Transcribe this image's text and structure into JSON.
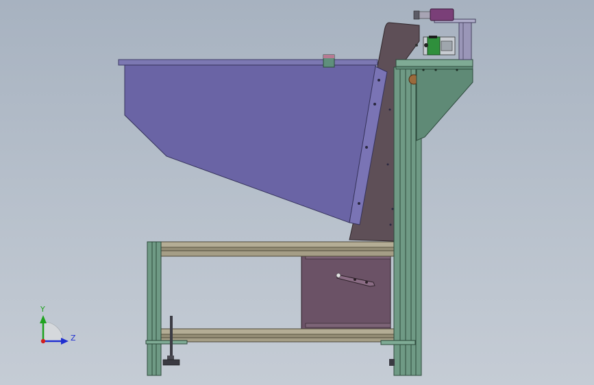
{
  "viewport": {
    "background_top": "#a7b2c0",
    "background_bottom": "#c5ccd5"
  },
  "model": {
    "colors": {
      "hopper_plate": "#6a64a5",
      "back_panel": "#5e4f57",
      "frame_green": "#6f9a85",
      "frame_green_dark": "#3d5d4d",
      "rail_tan": "#a59e86",
      "cabinet_door": "#6b5266",
      "bracket_green": "#5f8a76",
      "motor_purple": "#7a3f78",
      "motor_green": "#2f8f3c",
      "knob": "#9b6a3c"
    }
  },
  "triad": {
    "y_label": "Y",
    "z_label": "Z",
    "colors": {
      "y": "#1fa31f",
      "z": "#1f2fd1",
      "x": "#d11f1f"
    }
  }
}
